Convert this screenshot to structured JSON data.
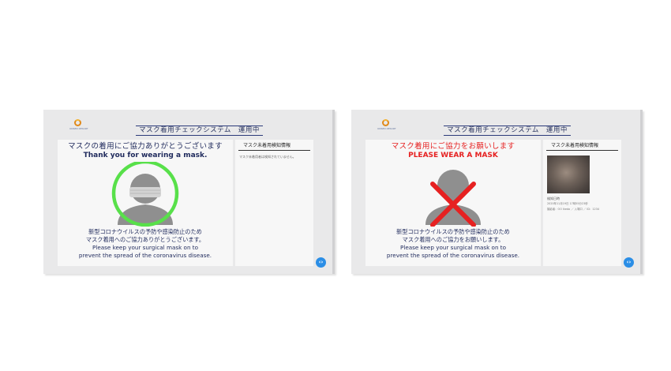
{
  "screens": {
    "left": {
      "logo_text": "ONSEN RESORT",
      "header_title": "マスク着用チェックシステム　運用中",
      "message_jp": "マスクの着用にご協力ありがとうございます",
      "message_en": "Thank you for wearing a mask.",
      "note_jp_line1": "新型コロナウイルスの予防や感染防止のため",
      "note_jp_line2": "マスク着用へのご協力ありがとうございます。",
      "note_en_line1": "Please keep your surgical mask on to",
      "note_en_line2": "prevent the spread of the coronavirus disease.",
      "side_title": "マスク未着用検知情報",
      "side_text": "マスク未着用者は検知されていません。",
      "nav_icon": "‹›"
    },
    "right": {
      "logo_text": "ONSEN RESORT",
      "header_title": "マスク着用チェックシステム　運用中",
      "message_jp": "マスク着用にご協力をお願いします",
      "message_en": "PLEASE WEAR A MASK",
      "note_jp_line1": "新型コロナウイルスの予防や感染防止のため",
      "note_jp_line2": "マスク着用へのご協力をお願いします。",
      "note_en_line1": "Please keep your surgical mask on to",
      "note_en_line2": "prevent the spread of the coronavirus disease.",
      "side_title": "マスク未着用検知情報",
      "detection_label": "検知日時",
      "detection_time": "2020年11月19日 17時55分23秒",
      "detection_meta": "撮影者：OO Ikeda  ／ 入場口  ／  ID：1234",
      "nav_icon": "‹›"
    }
  },
  "colors": {
    "ok_ring": "#58e04a",
    "ng_cross": "#e62121",
    "figure_gray": "#8f8f8f",
    "nav_blue": "#2b8ee6"
  }
}
